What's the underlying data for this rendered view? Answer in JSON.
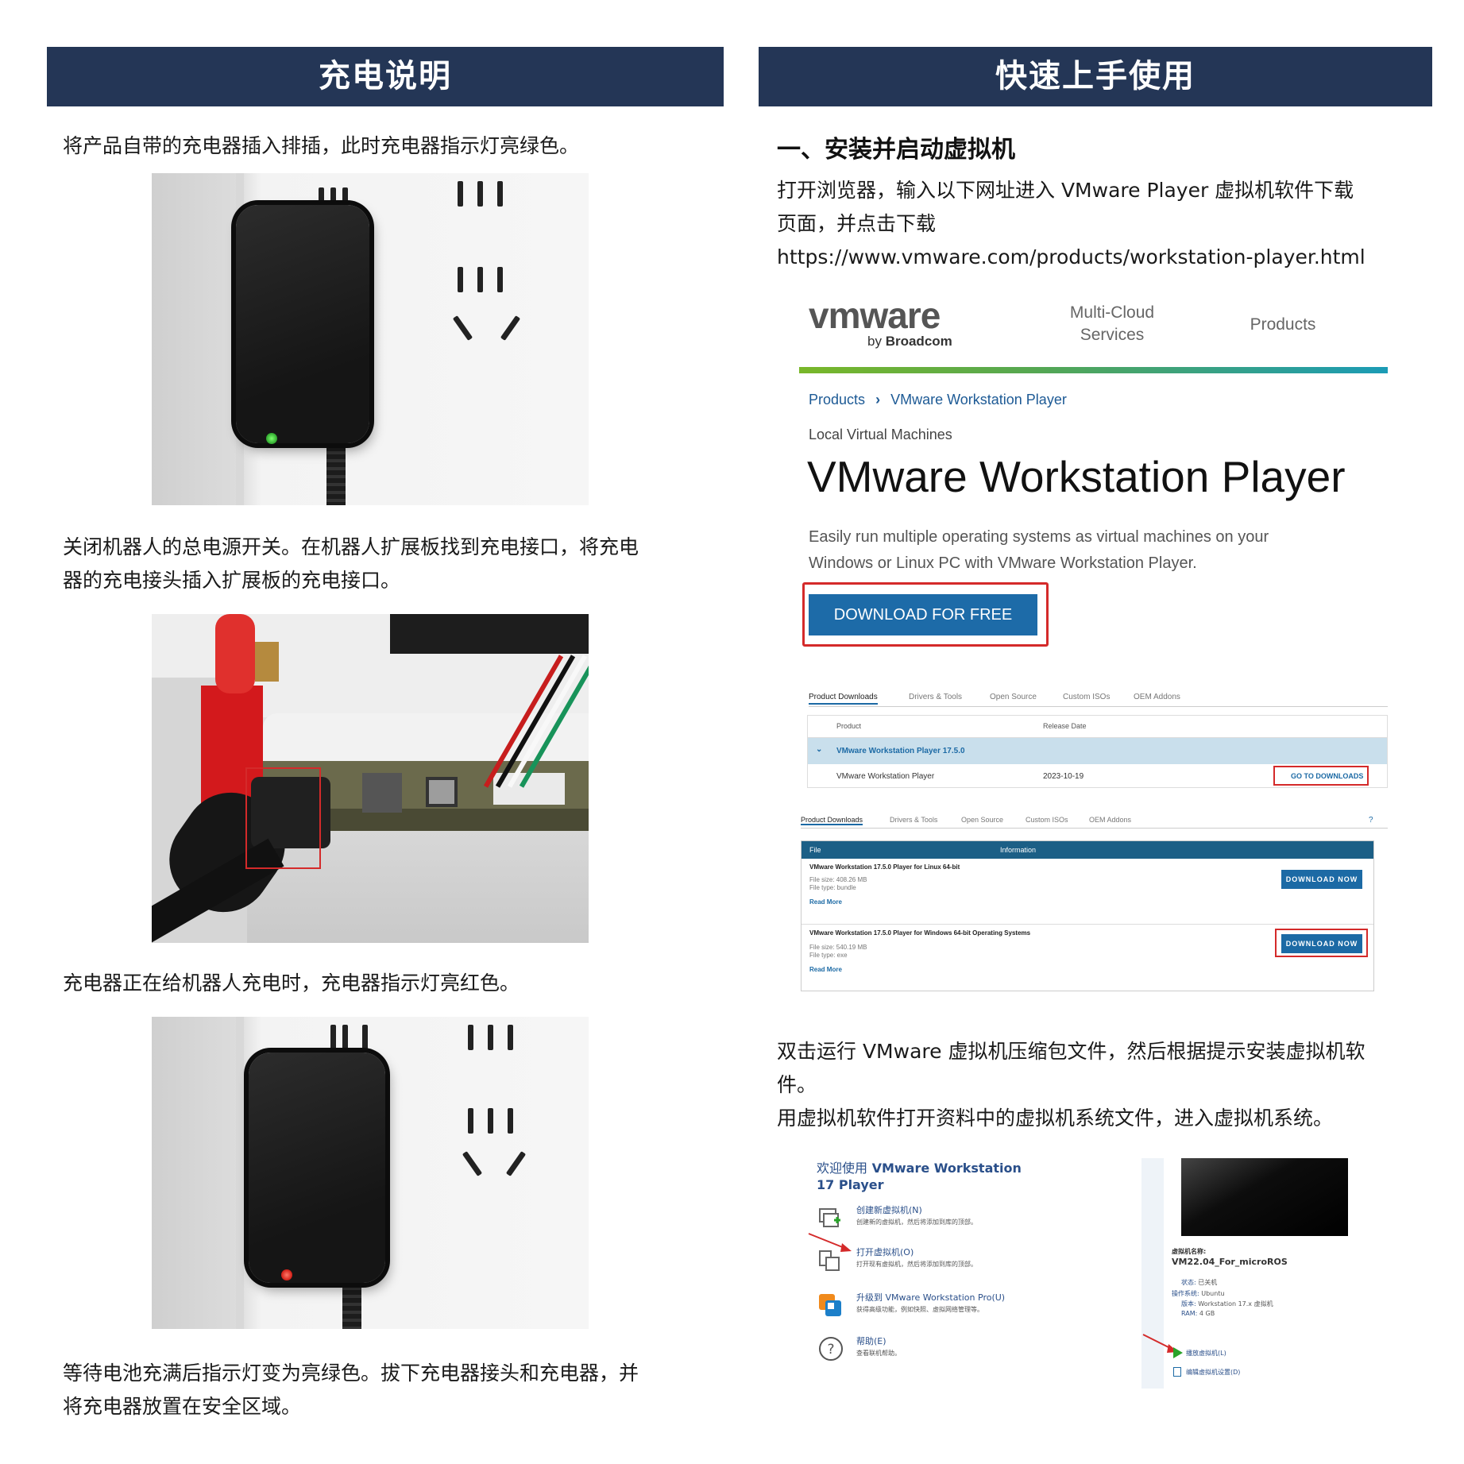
{
  "left": {
    "banner": "充电说明",
    "step1": "将产品自带的充电器插入排插，此时充电器指示灯亮绿色。",
    "step2_line1": "关闭机器人的总电源开关。在机器人扩展板找到充电接口，将充电",
    "step2_line2": "器的充电接头插入扩展板的充电接口。",
    "step3": "充电器正在给机器人充电时，充电器指示灯亮红色。",
    "step4_line1": "等待电池充满后指示灯变为亮绿色。拔下充电器接头和充电器，并",
    "step4_line2": "将充电器放置在安全区域。",
    "led_colors": {
      "charging": "#e02a20",
      "full": "#35c43a"
    }
  },
  "right": {
    "banner": "快速上手使用",
    "section1_heading": "一、安装并启动虚拟机",
    "intro_line1": "打开浏览器，输入以下网址进入 VMware Player 虚拟机软件下载",
    "intro_line2": "页面，并点击下载",
    "url": "https://www.vmware.com/products/workstation-player.html",
    "install_line1": "双击运行 VMware 虚拟机压缩包文件，然后根据提示安装虚拟机软",
    "install_line2": "件。",
    "open_line": "用虚拟机软件打开资料中的虚拟机系统文件，进入虚拟机系统。"
  },
  "vmware_page": {
    "logo": "vmware",
    "logo_sub_by": "by",
    "logo_sub_brand": "Broadcom",
    "nav_multicloud_1": "Multi-Cloud",
    "nav_multicloud_2": "Services",
    "nav_products": "Products",
    "breadcrumb_products": "Products",
    "breadcrumb_sep": "›",
    "breadcrumb_current": "VMware Workstation Player",
    "eyebrow": "Local Virtual Machines",
    "title": "VMware Workstation Player",
    "desc_line1": "Easily run multiple operating systems as virtual machines on your",
    "desc_line2": "Windows or Linux PC with VMware Workstation Player.",
    "download_button": "DOWNLOAD FOR FREE",
    "accent_color": "#1c6aa5"
  },
  "downloads_table": {
    "tabs": [
      "Product Downloads",
      "Drivers & Tools",
      "Open Source",
      "Custom ISOs",
      "OEM Addons"
    ],
    "col_product": "Product",
    "col_release": "Release Date",
    "group": "VMware Workstation Player 17.5.0",
    "row_name": "VMware Workstation Player",
    "row_date": "2023-10-19",
    "go_button": "GO TO DOWNLOADS"
  },
  "files_table": {
    "tabs": [
      "Product Downloads",
      "Drivers & Tools",
      "Open Source",
      "Custom ISOs",
      "OEM Addons"
    ],
    "col_file": "File",
    "col_info": "Information",
    "items": [
      {
        "name": "VMware Workstation 17.5.0 Player for Linux 64-bit",
        "size": "File size: 408.26 MB",
        "type": "File type: bundle",
        "more": "Read More",
        "button": "DOWNLOAD NOW"
      },
      {
        "name": "VMware Workstation 17.5.0 Player for Windows 64-bit Operating Systems",
        "size": "File size: 540.19 MB",
        "type": "File type: exe",
        "more": "Read More",
        "button": "DOWNLOAD NOW"
      }
    ]
  },
  "player_window": {
    "welcome_1": "欢迎使用",
    "welcome_brand": "VMware Workstation",
    "welcome_2": "17 Player",
    "actions": [
      {
        "title": "创建新虚拟机(N)",
        "desc": "创建新的虚拟机，然后将添加到库的顶部。",
        "icon": "new-vm-icon"
      },
      {
        "title": "打开虚拟机(O)",
        "desc": "打开现有虚拟机，然后将添加到库的顶部。",
        "icon": "open-vm-icon"
      },
      {
        "title": "升级到 VMware Workstation Pro(U)",
        "desc": "获得高级功能，例如快照、虚拟网络管理等。",
        "icon": "upgrade-icon"
      },
      {
        "title": "帮助(E)",
        "desc": "查看联机帮助。",
        "icon": "help-icon"
      }
    ],
    "vm_name_label": "虚拟机名称:",
    "vm_name": "VM22.04_For_microROS",
    "state_label": "状态:",
    "state_value": "已关机",
    "os_label": "操作系统:",
    "os_value": "Ubuntu",
    "version_label": "版本:",
    "version_value": "Workstation 17.x 虚拟机",
    "ram_label": "RAM:",
    "ram_value": "4 GB",
    "play_action": "播放虚拟机(L)",
    "settings_action": "编辑虚拟机设置(D)"
  }
}
